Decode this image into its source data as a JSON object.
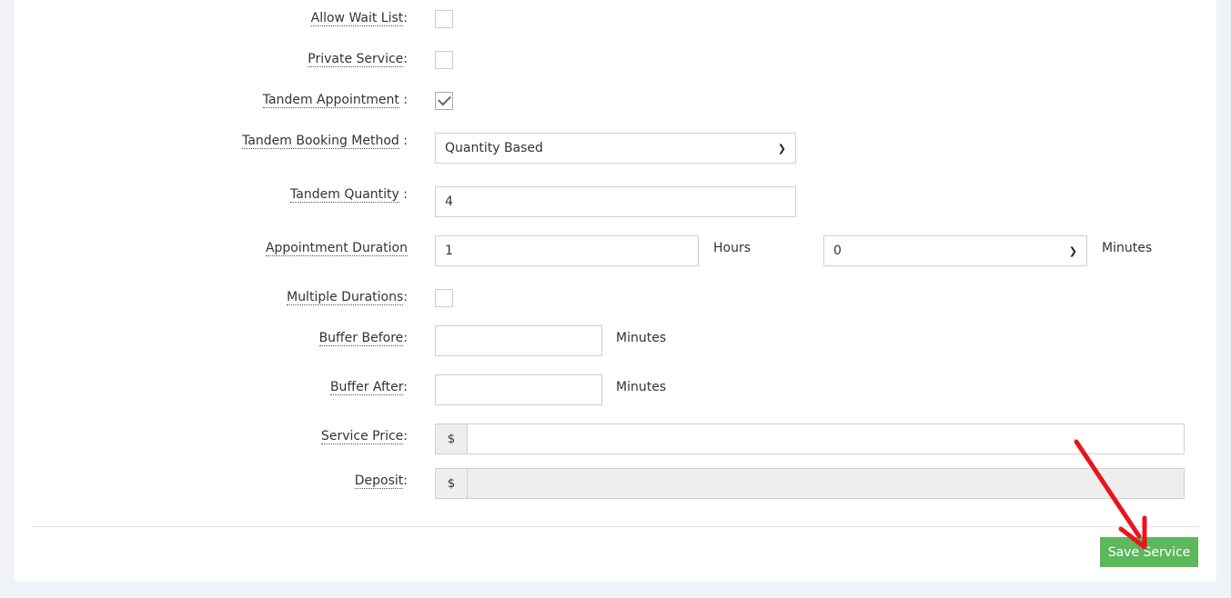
{
  "form": {
    "allow_wait_list": {
      "label": "Allow Wait List",
      "suffix": ":",
      "checked": false
    },
    "private_service": {
      "label": "Private Service",
      "suffix": ":",
      "checked": false
    },
    "tandem_appointment": {
      "label": "Tandem Appointment",
      "suffix": " :",
      "checked": true
    },
    "tandem_booking_method": {
      "label": "Tandem Booking Method",
      "suffix": " :",
      "value": "Quantity Based"
    },
    "tandem_quantity": {
      "label": "Tandem Quantity",
      "suffix": " :",
      "value": "4"
    },
    "appointment_duration": {
      "label": "Appointment Duration",
      "hours_value": "1",
      "hours_unit": "Hours",
      "minutes_value": "0",
      "minutes_unit": "Minutes"
    },
    "multiple_durations": {
      "label": "Multiple Durations",
      "suffix": ":",
      "checked": false
    },
    "buffer_before": {
      "label": "Buffer Before",
      "suffix": ":",
      "value": "",
      "unit": "Minutes"
    },
    "buffer_after": {
      "label": "Buffer After",
      "suffix": ":",
      "value": "",
      "unit": "Minutes"
    },
    "service_price": {
      "label": "Service Price",
      "suffix": ":",
      "currency": "$",
      "value": ""
    },
    "deposit": {
      "label": "Deposit",
      "suffix": ":",
      "currency": "$",
      "value": ""
    }
  },
  "actions": {
    "save_label": "Save Service"
  },
  "colors": {
    "save_button": "#5cb85c",
    "annotation_arrow": "#e8161c",
    "disabled_field": "#eeeeee"
  }
}
